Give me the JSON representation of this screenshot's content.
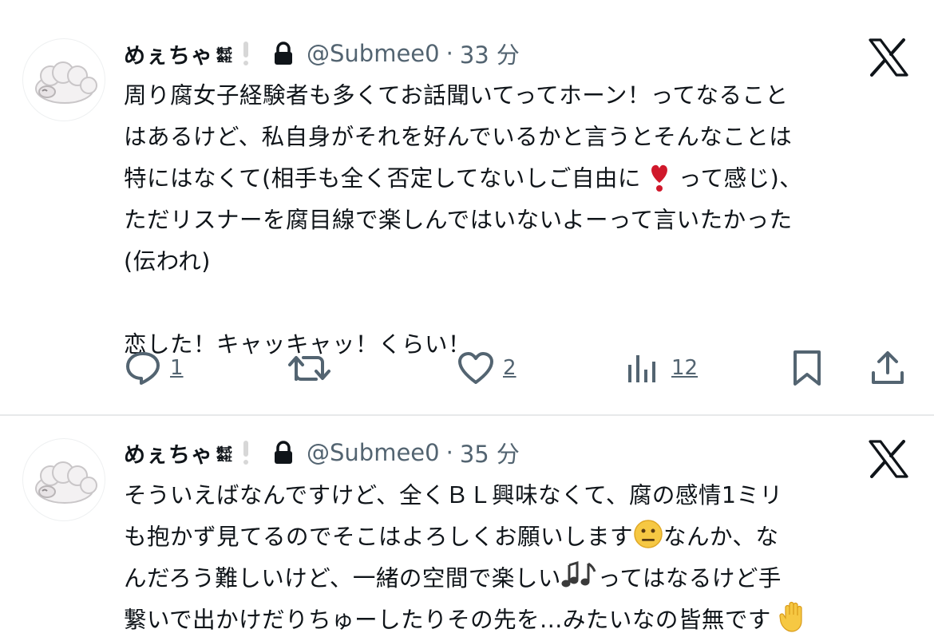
{
  "tweets": [
    {
      "author": {
        "name": "めぇちゃ",
        "name_symbol": "㍿",
        "handle": "@Submee0"
      },
      "time": "33 分",
      "separator": "·",
      "text": {
        "lines": [
          "周り腐女子経験者も多くてお話聞いてってホーン！ってなること",
          "はあるけど、私自身がそれを好んでいるかと言うとそんなことは",
          "特にはなくて(相手も全く否定してないしご自由に",
          "って感じ)、",
          "ただリスナーを腐目線で楽しんではいないよーって言いたかった",
          "(伝われ)",
          "恋した！キャッキャッ！くらい！"
        ]
      },
      "actions": {
        "replies": "1",
        "retweets": "",
        "likes": "2",
        "views": "12"
      }
    },
    {
      "author": {
        "name": "めぇちゃ",
        "name_symbol": "㍿",
        "handle": "@Submee0"
      },
      "time": "35 分",
      "separator": "·",
      "text": {
        "lines": [
          "そういえばなんですけど、全くＢＬ興味なくて、腐の感情1ミリ",
          "も抱かず見てるのでそこはよろしくお願いします",
          "なんか、な",
          "んだろう難しいけど、一緒の空間で楽しい",
          "ってはなるけど手",
          "繋いで出かけだりちゅーしたりその先を...みたいなの皆無です"
        ]
      }
    }
  ],
  "icons": {
    "verified_like": "exclamation-badge",
    "protected": "lock-icon",
    "brand": "x-logo",
    "reply": "reply-icon",
    "retweet": "retweet-icon",
    "like": "heart-icon",
    "views": "views-icon",
    "bookmark": "bookmark-icon",
    "share": "share-icon"
  },
  "colors": {
    "text": "#0f1419",
    "muted": "#536471",
    "divider": "#e7e9ea"
  }
}
